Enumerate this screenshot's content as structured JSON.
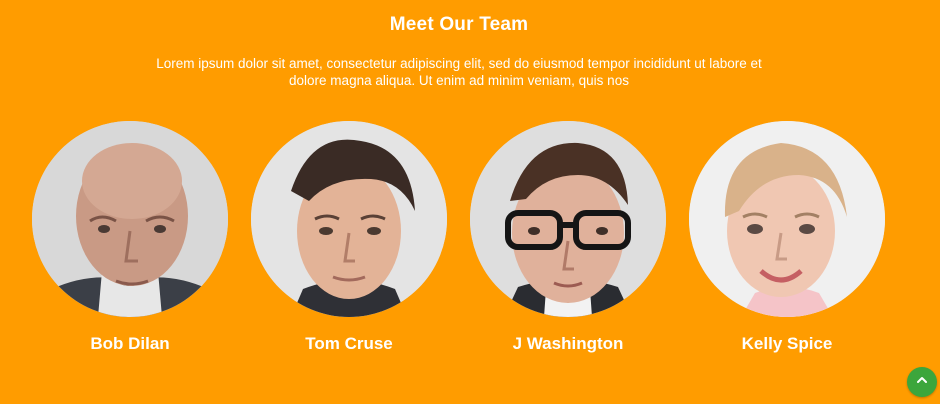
{
  "section": {
    "title": "Meet Our Team",
    "intro": "Lorem ipsum dolor sit amet, consectetur adipiscing elit, sed do eiusmod tempor incididunt ut labore et dolore magna aliqua. Ut enim ad minim veniam, quis nos"
  },
  "team": [
    {
      "name": "Bob Dilan"
    },
    {
      "name": "Tom Cruse"
    },
    {
      "name": "J Washington"
    },
    {
      "name": "Kelly Spice"
    }
  ],
  "back_to_top": {
    "icon": "chevron-up-icon"
  },
  "colors": {
    "background": "#FF9C00",
    "text": "#FFFFFF",
    "back_to_top": "#3CA63C"
  }
}
